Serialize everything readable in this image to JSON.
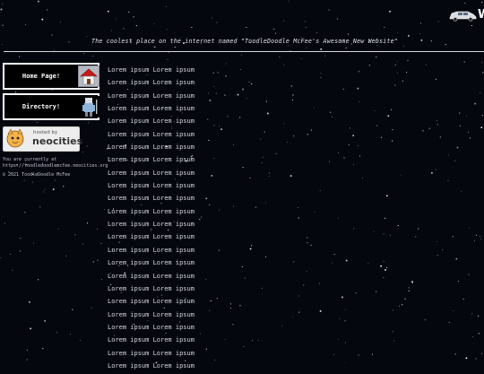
{
  "header": {
    "tagline": "The coolest place on the internet named \"ToodleDoodle McFee's Awesome New Website\"",
    "banner_letter": "W"
  },
  "nav": {
    "items": [
      {
        "label": "Home Page!",
        "icon": "house-icon"
      },
      {
        "label": "Directory!",
        "icon": "directory-figure-icon"
      }
    ]
  },
  "badge": {
    "text_line1": "hosted by",
    "text_line2": "neocities",
    "icon": "neocities-cat-icon"
  },
  "footer": {
    "url_note_line1": "You are currently at",
    "url_note_line2": "https://toodledoodlemcfee.neocities.org",
    "copyright": "© 2021 ToodleDoodle McFee"
  },
  "content": {
    "lines": [
      "Lorem ipsum Lorem ipsum",
      "Lorem ipsum Lorem ipsum",
      "Lorem ipsum Lorem ipsum",
      "Lorem ipsum Lorem ipsum",
      "Lorem ipsum Lorem ipsum",
      "Lorem ipsum Lorem ipsum",
      "Lorem ipsum Lorem ipsum",
      "Lorem ipsum Lorem ipsum",
      "Lorem ipsum Lorem ipsum",
      "Lorem ipsum Lorem ipsum",
      "Lorem ipsum Lorem ipsum",
      "Lorem ipsum Lorem ipsum",
      "Lorem ipsum Lorem ipsum",
      "Lorem ipsum Lorem ipsum",
      "Lorem ipsum Lorem ipsum",
      "Lorem ipsum Lorem ipsum",
      "Lorem ipsum Lorem ipsum",
      "Lorem ipsum Lorem ipsum",
      "Lorem ipsum Lorem ipsum",
      "Lorem ipsum Lorem ipsum",
      "Lorem ipsum Lorem ipsum",
      "Lorem ipsum Lorem ipsum",
      "Lorem ipsum Lorem ipsum",
      "Lorem ipsum Lorem ipsum"
    ]
  },
  "colors": {
    "background": "#05070f",
    "text": "#cfd2da",
    "rule": "#d8d8d8",
    "house_red": "#c81a1a"
  }
}
